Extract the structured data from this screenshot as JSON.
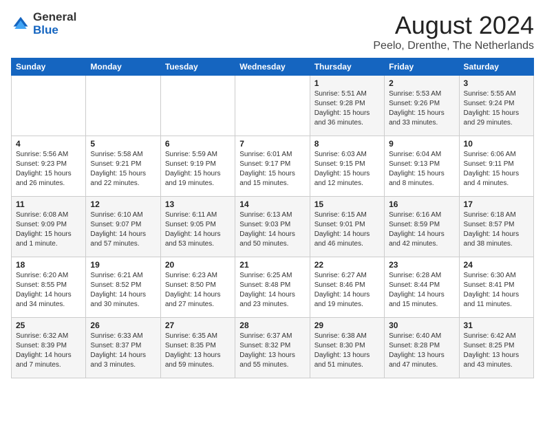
{
  "logo": {
    "general": "General",
    "blue": "Blue"
  },
  "title": "August 2024",
  "location": "Peelo, Drenthe, The Netherlands",
  "days_of_week": [
    "Sunday",
    "Monday",
    "Tuesday",
    "Wednesday",
    "Thursday",
    "Friday",
    "Saturday"
  ],
  "weeks": [
    [
      {
        "day": "",
        "info": ""
      },
      {
        "day": "",
        "info": ""
      },
      {
        "day": "",
        "info": ""
      },
      {
        "day": "",
        "info": ""
      },
      {
        "day": "1",
        "info": "Sunrise: 5:51 AM\nSunset: 9:28 PM\nDaylight: 15 hours\nand 36 minutes."
      },
      {
        "day": "2",
        "info": "Sunrise: 5:53 AM\nSunset: 9:26 PM\nDaylight: 15 hours\nand 33 minutes."
      },
      {
        "day": "3",
        "info": "Sunrise: 5:55 AM\nSunset: 9:24 PM\nDaylight: 15 hours\nand 29 minutes."
      }
    ],
    [
      {
        "day": "4",
        "info": "Sunrise: 5:56 AM\nSunset: 9:23 PM\nDaylight: 15 hours\nand 26 minutes."
      },
      {
        "day": "5",
        "info": "Sunrise: 5:58 AM\nSunset: 9:21 PM\nDaylight: 15 hours\nand 22 minutes."
      },
      {
        "day": "6",
        "info": "Sunrise: 5:59 AM\nSunset: 9:19 PM\nDaylight: 15 hours\nand 19 minutes."
      },
      {
        "day": "7",
        "info": "Sunrise: 6:01 AM\nSunset: 9:17 PM\nDaylight: 15 hours\nand 15 minutes."
      },
      {
        "day": "8",
        "info": "Sunrise: 6:03 AM\nSunset: 9:15 PM\nDaylight: 15 hours\nand 12 minutes."
      },
      {
        "day": "9",
        "info": "Sunrise: 6:04 AM\nSunset: 9:13 PM\nDaylight: 15 hours\nand 8 minutes."
      },
      {
        "day": "10",
        "info": "Sunrise: 6:06 AM\nSunset: 9:11 PM\nDaylight: 15 hours\nand 4 minutes."
      }
    ],
    [
      {
        "day": "11",
        "info": "Sunrise: 6:08 AM\nSunset: 9:09 PM\nDaylight: 15 hours\nand 1 minute."
      },
      {
        "day": "12",
        "info": "Sunrise: 6:10 AM\nSunset: 9:07 PM\nDaylight: 14 hours\nand 57 minutes."
      },
      {
        "day": "13",
        "info": "Sunrise: 6:11 AM\nSunset: 9:05 PM\nDaylight: 14 hours\nand 53 minutes."
      },
      {
        "day": "14",
        "info": "Sunrise: 6:13 AM\nSunset: 9:03 PM\nDaylight: 14 hours\nand 50 minutes."
      },
      {
        "day": "15",
        "info": "Sunrise: 6:15 AM\nSunset: 9:01 PM\nDaylight: 14 hours\nand 46 minutes."
      },
      {
        "day": "16",
        "info": "Sunrise: 6:16 AM\nSunset: 8:59 PM\nDaylight: 14 hours\nand 42 minutes."
      },
      {
        "day": "17",
        "info": "Sunrise: 6:18 AM\nSunset: 8:57 PM\nDaylight: 14 hours\nand 38 minutes."
      }
    ],
    [
      {
        "day": "18",
        "info": "Sunrise: 6:20 AM\nSunset: 8:55 PM\nDaylight: 14 hours\nand 34 minutes."
      },
      {
        "day": "19",
        "info": "Sunrise: 6:21 AM\nSunset: 8:52 PM\nDaylight: 14 hours\nand 30 minutes."
      },
      {
        "day": "20",
        "info": "Sunrise: 6:23 AM\nSunset: 8:50 PM\nDaylight: 14 hours\nand 27 minutes."
      },
      {
        "day": "21",
        "info": "Sunrise: 6:25 AM\nSunset: 8:48 PM\nDaylight: 14 hours\nand 23 minutes."
      },
      {
        "day": "22",
        "info": "Sunrise: 6:27 AM\nSunset: 8:46 PM\nDaylight: 14 hours\nand 19 minutes."
      },
      {
        "day": "23",
        "info": "Sunrise: 6:28 AM\nSunset: 8:44 PM\nDaylight: 14 hours\nand 15 minutes."
      },
      {
        "day": "24",
        "info": "Sunrise: 6:30 AM\nSunset: 8:41 PM\nDaylight: 14 hours\nand 11 minutes."
      }
    ],
    [
      {
        "day": "25",
        "info": "Sunrise: 6:32 AM\nSunset: 8:39 PM\nDaylight: 14 hours\nand 7 minutes."
      },
      {
        "day": "26",
        "info": "Sunrise: 6:33 AM\nSunset: 8:37 PM\nDaylight: 14 hours\nand 3 minutes."
      },
      {
        "day": "27",
        "info": "Sunrise: 6:35 AM\nSunset: 8:35 PM\nDaylight: 13 hours\nand 59 minutes."
      },
      {
        "day": "28",
        "info": "Sunrise: 6:37 AM\nSunset: 8:32 PM\nDaylight: 13 hours\nand 55 minutes."
      },
      {
        "day": "29",
        "info": "Sunrise: 6:38 AM\nSunset: 8:30 PM\nDaylight: 13 hours\nand 51 minutes."
      },
      {
        "day": "30",
        "info": "Sunrise: 6:40 AM\nSunset: 8:28 PM\nDaylight: 13 hours\nand 47 minutes."
      },
      {
        "day": "31",
        "info": "Sunrise: 6:42 AM\nSunset: 8:25 PM\nDaylight: 13 hours\nand 43 minutes."
      }
    ]
  ]
}
